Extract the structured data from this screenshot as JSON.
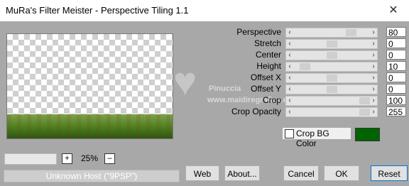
{
  "window": {
    "title": "MuRa's Filter Meister - Perspective Tiling 1.1",
    "close_label": "✕"
  },
  "preview": {
    "zoom": "25%",
    "zoom_plus": "+",
    "zoom_minus": "–"
  },
  "status": {
    "host": "Unknown Host (\"9PSP\")"
  },
  "params": [
    {
      "label": "Perspective",
      "value": "80",
      "thumb_pos": 0.8
    },
    {
      "label": "Stretch",
      "value": "0",
      "thumb_pos": 0.5
    },
    {
      "label": "Center",
      "value": "0",
      "thumb_pos": 0.5
    },
    {
      "label": "Height",
      "value": "10",
      "thumb_pos": 0.1
    },
    {
      "label": "Offset X",
      "value": "0",
      "thumb_pos": 0.5
    },
    {
      "label": "Offset Y",
      "value": "0",
      "thumb_pos": 0.5
    },
    {
      "label": "Crop",
      "value": "100",
      "thumb_pos": 1.0
    },
    {
      "label": "Crop Opacity",
      "value": "255",
      "thumb_pos": 1.0
    }
  ],
  "crop_bg": {
    "label": "Crop BG Color",
    "checked": false,
    "color": "#006400"
  },
  "buttons": {
    "web": "Web",
    "about": "About...",
    "cancel": "Cancel",
    "ok": "OK",
    "reset": "Reset"
  },
  "watermark": {
    "line1": "Pinuccia",
    "line2": "www.maidiregrafica.eu"
  }
}
